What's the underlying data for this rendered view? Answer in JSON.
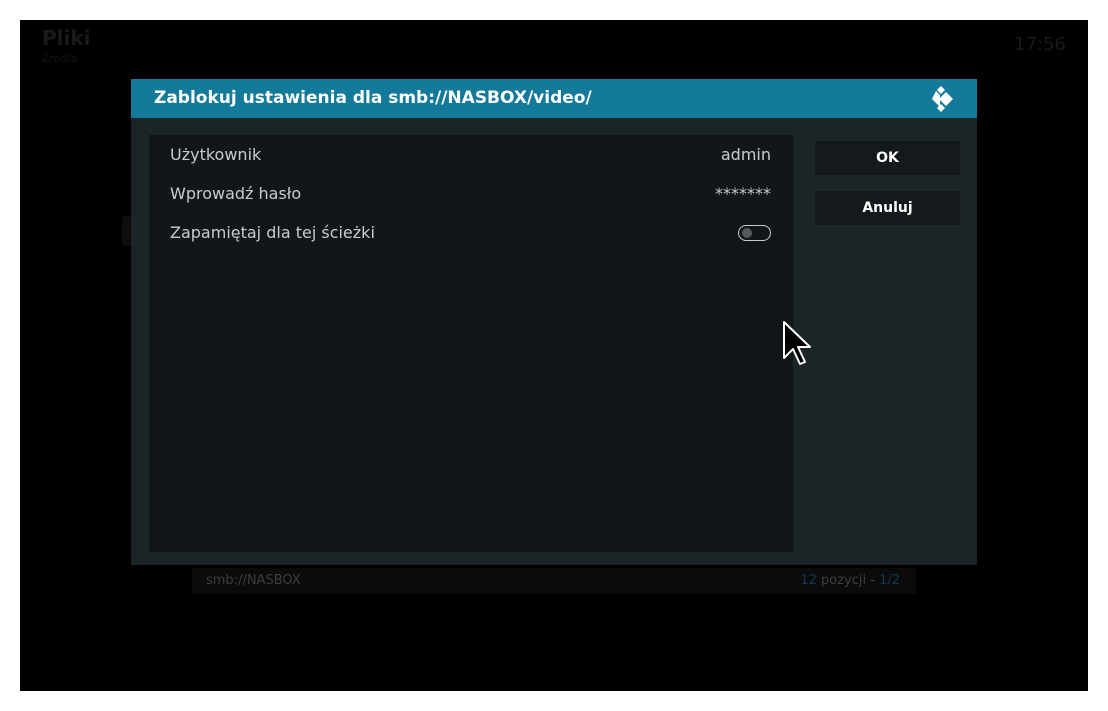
{
  "background": {
    "title": "Pliki",
    "subtitle": "Źródła",
    "clock": "17:56",
    "footer": {
      "path": "smb://NASBOX",
      "count_num": "12",
      "count_word": "pozycji",
      "separator": "-",
      "page": "1/2"
    }
  },
  "dialog": {
    "title": "Zablokuj ustawienia dla smb://NASBOX/video/",
    "logo_icon": "kodi-logo-icon",
    "rows": [
      {
        "label": "Użytkownik",
        "value": "admin"
      },
      {
        "label": "Wprowadź hasło",
        "value": "*******"
      },
      {
        "label": "Zapamiętaj dla tej ścieżki",
        "toggle": false
      }
    ],
    "buttons": {
      "ok": "OK",
      "cancel": "Anuluj"
    }
  },
  "colors": {
    "header": "#147a99",
    "dialog_bg": "#1b2427",
    "panel_bg": "#111718",
    "button_bg": "#141a1c"
  }
}
